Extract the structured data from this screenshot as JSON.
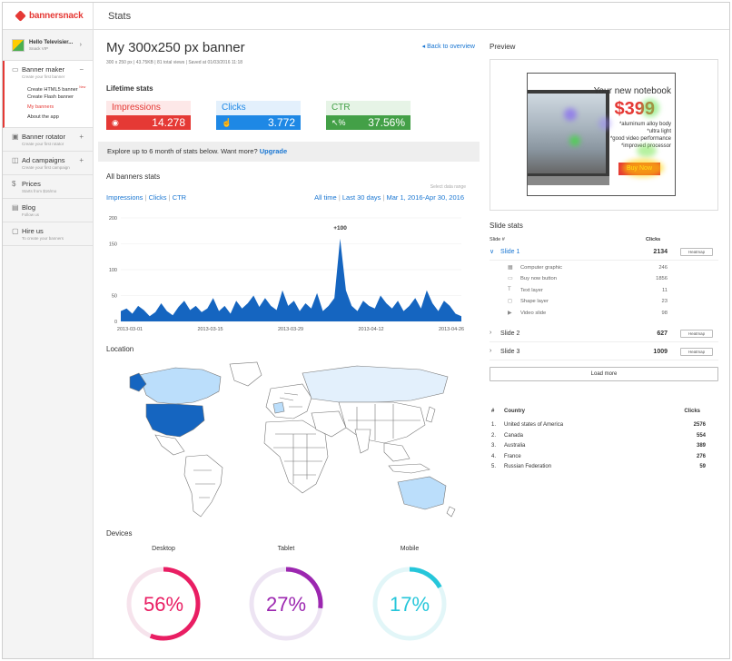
{
  "app": {
    "logo": "bannersnack",
    "section": "Stats"
  },
  "user": {
    "name": "Hello Televisier...",
    "plan": "Snack VIP"
  },
  "sidebar": {
    "banner_maker": {
      "title": "Banner maker",
      "desc": "Create your first banner",
      "items": [
        "Create HTML5 banner",
        "Create Flash banner",
        "My banners",
        "About the app"
      ],
      "new_badge": "New"
    },
    "banner_rotator": {
      "title": "Banner rotator",
      "desc": "Create your first rotator"
    },
    "ad_campaigns": {
      "title": "Ad campaigns",
      "desc": "Create your first campaign"
    },
    "prices": {
      "title": "Prices",
      "desc": "Starts from $16/mo"
    },
    "blog": {
      "title": "Blog",
      "desc": "Follow us"
    },
    "hire_us": {
      "title": "Hire us",
      "desc": "To create your banners"
    }
  },
  "main": {
    "title": "My 300x250 px banner",
    "back": "Back to overview",
    "meta": "300 x 250 px  |  43.75KB  |  81 total views  |  Saved at 01/03/2016 11:18",
    "lifetime_title": "Lifetime stats",
    "stats": [
      {
        "label": "Impressions",
        "value": "14.278",
        "icon": "eye-icon",
        "color": "#e53935"
      },
      {
        "label": "Clicks",
        "value": "3.772",
        "icon": "cursor-icon",
        "color": "#1e88e5"
      },
      {
        "label": "CTR",
        "value": "37.56%",
        "icon": "percent-icon",
        "color": "#43a047"
      }
    ],
    "banner_text": "Explore up to 6 month of stats below. Want more?",
    "upgrade": "Upgrade",
    "all_banners_title": "All banners stats",
    "select_range": "Select data range",
    "metrics": [
      "Impressions",
      "Clicks",
      "CTR"
    ],
    "ranges": [
      "All time",
      "Last 30 days",
      "Mar 1, 2016-Apr 30, 2016"
    ],
    "location_title": "Location",
    "devices_title": "Devices",
    "devices": [
      {
        "label": "Desktop",
        "value": 56,
        "text": "56%",
        "color": "#e91e63"
      },
      {
        "label": "Tablet",
        "value": 27,
        "text": "27%",
        "color": "#9c27b0"
      },
      {
        "label": "Mobile",
        "value": 17,
        "text": "17%",
        "color": "#26c6da"
      }
    ]
  },
  "chart_data": {
    "type": "area",
    "color": "#1565c0",
    "annotation": "+100",
    "yticks": [
      0,
      50,
      100,
      150,
      200
    ],
    "xticks": [
      "2013-03-01",
      "2013-03-15",
      "2013-03-29",
      "2013-04-12",
      "2013-04-26"
    ],
    "ylim": [
      0,
      200
    ],
    "values": [
      20,
      25,
      15,
      30,
      22,
      10,
      18,
      35,
      20,
      12,
      28,
      40,
      22,
      30,
      18,
      25,
      45,
      20,
      30,
      15,
      40,
      25,
      35,
      50,
      28,
      45,
      30,
      22,
      60,
      30,
      40,
      20,
      35,
      25,
      55,
      20,
      30,
      45,
      160,
      60,
      30,
      20,
      40,
      30,
      25,
      50,
      35,
      25,
      40,
      20,
      30,
      45,
      25,
      60,
      35,
      20,
      40,
      30,
      15,
      10
    ]
  },
  "map": {
    "highlight_dark": "#1565c0",
    "highlight_light": "#bbdefb",
    "base": "#ffffff",
    "stroke": "#777"
  },
  "preview": {
    "title": "Preview",
    "headline": "Your new notebook",
    "price": "$399",
    "features": [
      "*aluminum alloy body",
      "*ultra light",
      "*good video performance",
      "*improved processor"
    ],
    "button": "Buy Now"
  },
  "slide_stats": {
    "title": "Slide stats",
    "col_slide": "Slide #",
    "col_clicks": "Clicks",
    "heatmap": "Heatmap",
    "slides": [
      {
        "name": "Slide 1",
        "clicks": "2134",
        "expanded": true
      },
      {
        "name": "Slide 2",
        "clicks": "627"
      },
      {
        "name": "Slide 3",
        "clicks": "1009"
      }
    ],
    "layers": [
      {
        "icon": "image-icon",
        "name": "Computer graphic",
        "value": "246"
      },
      {
        "icon": "button-icon",
        "name": "Buy now button",
        "value": "1856"
      },
      {
        "icon": "text-icon",
        "name": "Text layer",
        "value": "11"
      },
      {
        "icon": "shape-icon",
        "name": "Shape layer",
        "value": "23"
      },
      {
        "icon": "video-icon",
        "name": "Video slide",
        "value": "98"
      }
    ],
    "load_more": "Load more"
  },
  "countries": {
    "col_num": "#",
    "col_country": "Country",
    "col_clicks": "Clicks",
    "rows": [
      {
        "n": "1.",
        "name": "United states of America",
        "clicks": "2576"
      },
      {
        "n": "2.",
        "name": "Canada",
        "clicks": "554"
      },
      {
        "n": "3.",
        "name": "Australia",
        "clicks": "389"
      },
      {
        "n": "4.",
        "name": "France",
        "clicks": "276"
      },
      {
        "n": "5.",
        "name": "Russian Federation",
        "clicks": "59"
      }
    ]
  }
}
